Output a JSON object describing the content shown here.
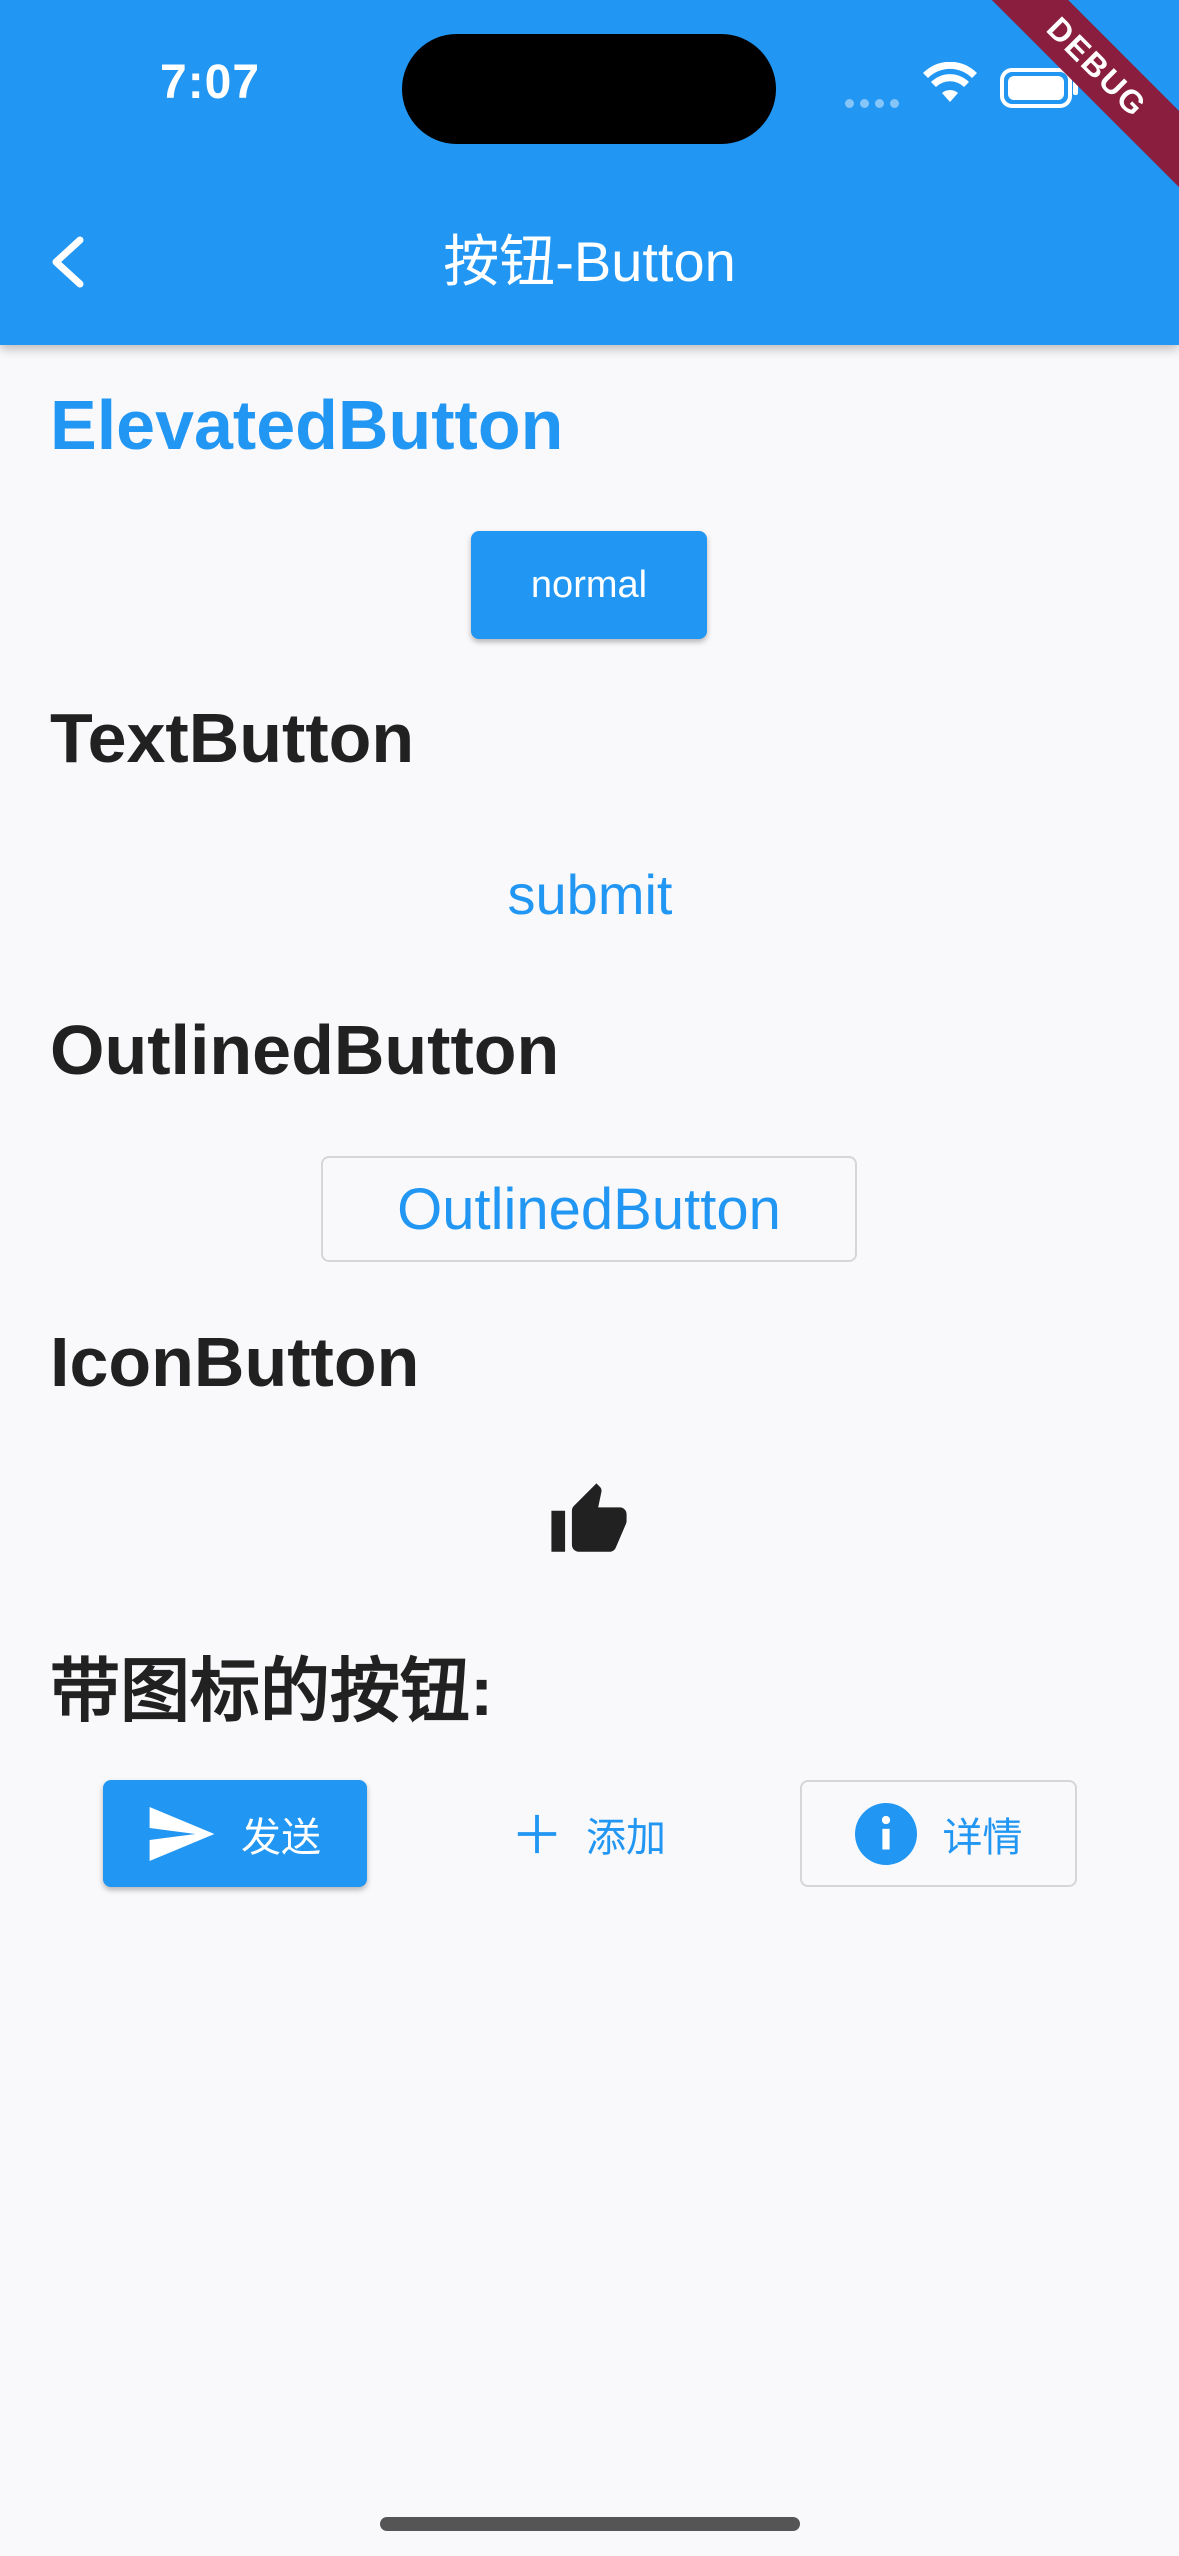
{
  "status_bar": {
    "time": "7:07"
  },
  "debug_banner": "DEBUG",
  "app_bar": {
    "title": "按钮-Button"
  },
  "sections": {
    "elevated": {
      "title": "ElevatedButton",
      "button": "normal"
    },
    "text": {
      "title": "TextButton",
      "button": "submit"
    },
    "outlined": {
      "title": "OutlinedButton",
      "button": "OutlinedButton"
    },
    "icon": {
      "title": "IconButton",
      "icon": "thumb-up-icon"
    },
    "icon_buttons": {
      "title": "带图标的按钮:",
      "send": "发送",
      "add": "添加",
      "info": "详情"
    }
  },
  "colors": {
    "primary": "#2196f3",
    "debug": "#8a1e3e",
    "text": "#212121"
  }
}
